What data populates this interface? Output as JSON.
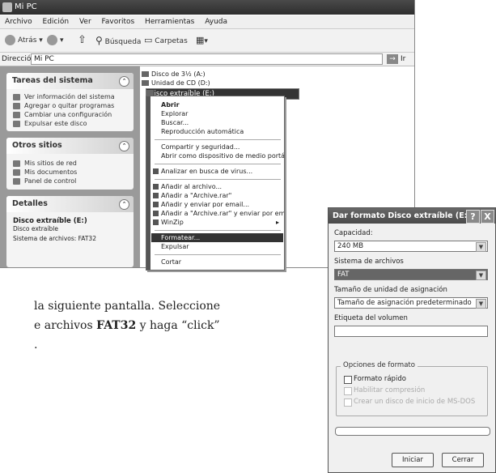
{
  "explorer": {
    "title": "Mi PC",
    "menu": [
      "Archivo",
      "Edición",
      "Ver",
      "Favoritos",
      "Herramientas",
      "Ayuda"
    ],
    "toolbar": {
      "back": "Atrás",
      "search": "Búsqueda",
      "folders": "Carpetas"
    },
    "address_label": "Dirección",
    "address_value": "Mi PC",
    "go_label": "Ir",
    "panels": [
      {
        "title": "Tareas del sistema",
        "items": [
          "Ver información del sistema",
          "Agregar o quitar programas",
          "Cambiar una configuración",
          "Expulsar este disco"
        ]
      },
      {
        "title": "Otros sitios",
        "items": [
          "Mis sitios de red",
          "Mis documentos",
          "Panel de control"
        ]
      },
      {
        "title": "Detalles",
        "name": "Disco extraíble (E:)",
        "kind": "Disco extraíble",
        "fs": "Sistema de archivos: FAT32"
      }
    ],
    "drives": [
      "Disco de 3½ (A:)",
      "Unidad de CD (D:)",
      "Disco extraíble (E:)"
    ]
  },
  "context_menu": [
    "Abrir",
    "Explorar",
    "Buscar...",
    "Reproducción automática",
    "Compartir y seguridad...",
    "Abrir como dispositivo de medio portátil...",
    "Analizar en busca de virus...",
    "Añadir al archivo...",
    "Añadir a \"Archive.rar\"",
    "Añadir y enviar por email...",
    "Añadir a \"Archive.rar\" y enviar por email",
    "WinZip",
    "Formatear...",
    "Expulsar",
    "Cortar"
  ],
  "body_text": {
    "line1": "la siguiente pantalla. Seleccione",
    "line2_a": "e archivos ",
    "line2_b": "FAT32",
    "line2_c": " y haga “click”",
    "line3": "."
  },
  "format_dialog": {
    "title": "Dar formato Disco extraíble (E:)",
    "help": "?",
    "close": "X",
    "capacity_label": "Capacidad:",
    "capacity_value": "240 MB",
    "fs_label": "Sistema de archivos",
    "fs_value": "FAT",
    "alloc_label": "Tamaño de unidad de asignación",
    "alloc_value": "Tamaño de asignación predeterminado",
    "volume_label": "Etiqueta del volumen",
    "volume_value": "",
    "options_label": "Opciones de formato",
    "quick_format": "Formato rápido",
    "compression": "Habilitar compresión",
    "msdos_disk": "Crear un disco de inicio de MS-DOS",
    "start_button": "Iniciar",
    "close_button": "Cerrar"
  }
}
